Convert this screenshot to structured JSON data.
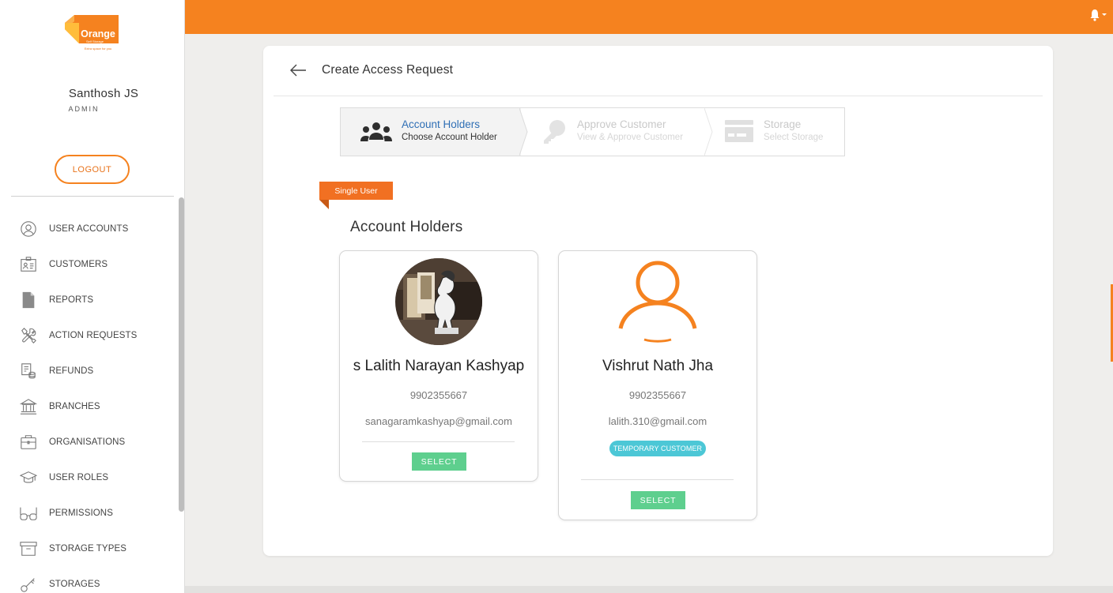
{
  "brand": {
    "logo_text": "Orange",
    "logo_sub": "Self Storage",
    "logo_tagline": "Extra space for you",
    "accent": "#f5821f"
  },
  "user": {
    "name": "Santhosh JS",
    "role": "ADMIN",
    "logout_label": "LOGOUT"
  },
  "nav": {
    "items": [
      {
        "label": "USER ACCOUNTS",
        "icon": "user-circle-icon"
      },
      {
        "label": "CUSTOMERS",
        "icon": "id-card-icon"
      },
      {
        "label": "REPORTS",
        "icon": "document-icon"
      },
      {
        "label": "ACTION REQUESTS",
        "icon": "tools-icon"
      },
      {
        "label": "REFUNDS",
        "icon": "refund-icon"
      },
      {
        "label": "BRANCHES",
        "icon": "bank-icon"
      },
      {
        "label": "ORGANISATIONS",
        "icon": "briefcase-icon"
      },
      {
        "label": "USER ROLES",
        "icon": "graduation-cap-icon"
      },
      {
        "label": "PERMISSIONS",
        "icon": "glasses-icon"
      },
      {
        "label": "STORAGE TYPES",
        "icon": "archive-box-icon"
      },
      {
        "label": "STORAGES",
        "icon": "key-icon"
      }
    ]
  },
  "page": {
    "title": "Create Access Request"
  },
  "stepper": {
    "steps": [
      {
        "title": "Account Holders",
        "subtitle": "Choose Account Holder",
        "state": "active"
      },
      {
        "title": "Approve Customer",
        "subtitle": "View & Approve Customer",
        "state": "disabled"
      },
      {
        "title": "Storage",
        "subtitle": "Select Storage",
        "state": "disabled"
      }
    ]
  },
  "ribbon": {
    "label": "Single User"
  },
  "section": {
    "title": "Account Holders"
  },
  "holders": [
    {
      "name": "s Lalith Narayan Kashyap",
      "phone": "9902355667",
      "email": "sanagaramkashyap@gmail.com",
      "tag": "",
      "select_label": "SELECT"
    },
    {
      "name": "Vishrut Nath Jha",
      "phone": "9902355667",
      "email": "lalith.310@gmail.com",
      "tag": "TEMPORARY CUSTOMER",
      "select_label": "SELECT"
    }
  ]
}
